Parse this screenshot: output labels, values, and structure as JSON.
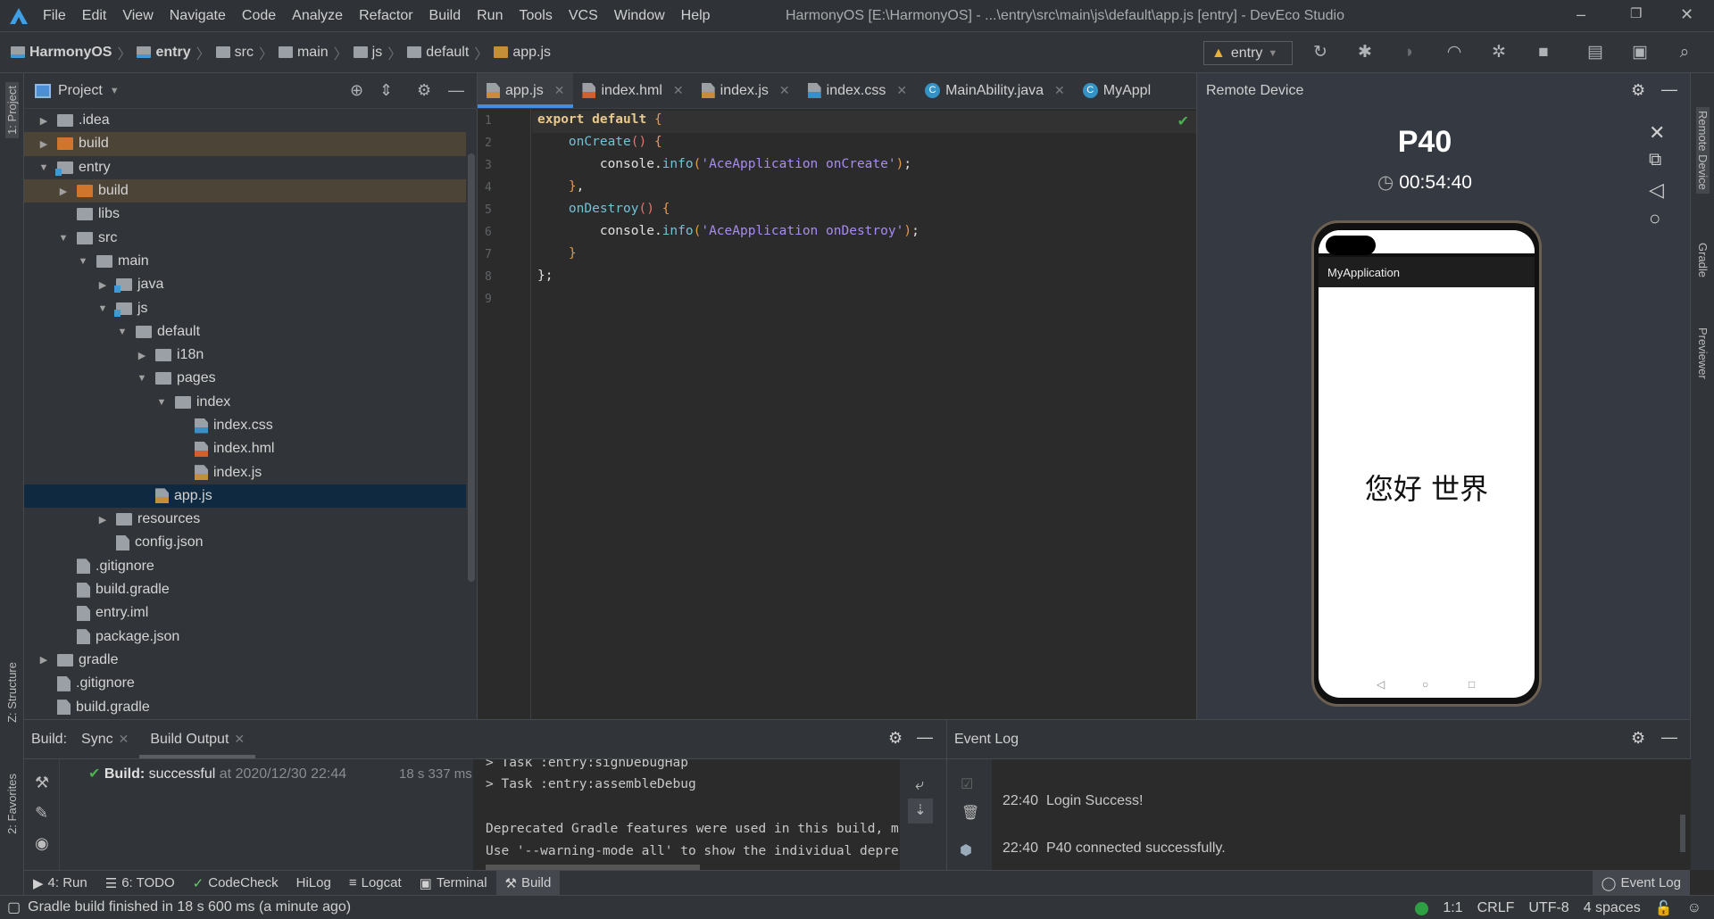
{
  "menu": {
    "items": [
      "File",
      "Edit",
      "View",
      "Navigate",
      "Code",
      "Analyze",
      "Refactor",
      "Build",
      "Run",
      "Tools",
      "VCS",
      "Window",
      "Help"
    ],
    "title": "HarmonyOS [E:\\HarmonyOS] - ...\\entry\\src\\main\\js\\default\\app.js [entry] - DevEco Studio"
  },
  "breadcrumb": [
    "HarmonyOS",
    "entry",
    "src",
    "main",
    "js",
    "default",
    "app.js"
  ],
  "toolbar": {
    "run_config": "entry"
  },
  "left_strip": {
    "project": "1: Project",
    "structure": "Z: Structure",
    "favorites": "2: Favorites"
  },
  "right_strip": {
    "remote": "Remote Device",
    "gradle": "Gradle",
    "previewer": "Previewer"
  },
  "project": {
    "title": "Project",
    "tree": [
      {
        "label": ".idea",
        "level": 1,
        "type": "folder",
        "arrow": "collapsed"
      },
      {
        "label": "build",
        "level": 1,
        "type": "folder",
        "color": "orange",
        "arrow": "collapsed",
        "hl": true
      },
      {
        "label": "entry",
        "level": 1,
        "type": "folder",
        "module": true,
        "arrow": "expanded"
      },
      {
        "label": "build",
        "level": 2,
        "type": "folder",
        "color": "orange",
        "arrow": "collapsed",
        "hl": true
      },
      {
        "label": "libs",
        "level": 2,
        "type": "folder"
      },
      {
        "label": "src",
        "level": 2,
        "type": "folder",
        "arrow": "expanded"
      },
      {
        "label": "main",
        "level": 3,
        "type": "folder",
        "arrow": "expanded"
      },
      {
        "label": "java",
        "level": 4,
        "type": "folder",
        "module": true,
        "arrow": "collapsed"
      },
      {
        "label": "js",
        "level": 4,
        "type": "folder",
        "module": true,
        "arrow": "expanded"
      },
      {
        "label": "default",
        "level": 5,
        "type": "folder",
        "arrow": "expanded"
      },
      {
        "label": "i18n",
        "level": 6,
        "type": "folder",
        "arrow": "collapsed"
      },
      {
        "label": "pages",
        "level": 6,
        "type": "folder",
        "arrow": "expanded"
      },
      {
        "label": "index",
        "level": 7,
        "type": "folder",
        "arrow": "expanded"
      },
      {
        "label": "index.css",
        "level": 8,
        "type": "css"
      },
      {
        "label": "index.hml",
        "level": 8,
        "type": "hml"
      },
      {
        "label": "index.js",
        "level": 8,
        "type": "js"
      },
      {
        "label": "app.js",
        "level": 6,
        "type": "js",
        "selected": true
      },
      {
        "label": "resources",
        "level": 4,
        "type": "folder",
        "arrow": "collapsed"
      },
      {
        "label": "config.json",
        "level": 4,
        "type": "json"
      },
      {
        "label": ".gitignore",
        "level": 2,
        "type": "generic"
      },
      {
        "label": "build.gradle",
        "level": 2,
        "type": "gradle"
      },
      {
        "label": "entry.iml",
        "level": 2,
        "type": "generic"
      },
      {
        "label": "package.json",
        "level": 2,
        "type": "json"
      },
      {
        "label": "gradle",
        "level": 1,
        "type": "folder",
        "arrow": "collapsed"
      },
      {
        "label": ".gitignore",
        "level": 1,
        "type": "generic"
      },
      {
        "label": "build.gradle",
        "level": 1,
        "type": "gradle"
      }
    ]
  },
  "editor": {
    "tabs": [
      {
        "label": "app.js",
        "type": "js",
        "active": true,
        "closable": true
      },
      {
        "label": "index.hml",
        "type": "hml",
        "closable": true
      },
      {
        "label": "index.js",
        "type": "js",
        "closable": true
      },
      {
        "label": "index.css",
        "type": "css",
        "closable": true
      },
      {
        "label": "MainAbility.java",
        "type": "class",
        "closable": true
      },
      {
        "label": "MyAppl",
        "type": "class",
        "closable": false
      }
    ],
    "line_numbers": [
      "1",
      "2",
      "3",
      "4",
      "5",
      "6",
      "7",
      "8",
      "9"
    ],
    "code": {
      "l1a": "export default",
      "l1b": " {",
      "l2a": "    onCreate",
      "l2b": "()",
      "l2c": " {",
      "l3a": "        console.",
      "l3b": "info",
      "l3c": "(",
      "l3d": "'AceApplication onCreate'",
      "l3e": ")",
      "l3f": ";",
      "l4a": "    }",
      "l4b": ",",
      "l5a": "    onDestroy",
      "l5b": "()",
      "l5c": " {",
      "l6a": "        console.",
      "l6b": "info",
      "l6c": "(",
      "l6d": "'AceApplication onDestroy'",
      "l6e": ")",
      "l6f": ";",
      "l7a": "    }",
      "l8a": "};"
    }
  },
  "remote": {
    "title": "Remote Device",
    "device": "P40",
    "timer": "00:54:40",
    "app_title": "MyApplication",
    "content": "您好 世界"
  },
  "build": {
    "label": "Build:",
    "tabs": [
      "Sync",
      "Build Output"
    ],
    "status_bold": "Build:",
    "status": " successful",
    "at": " at 2020/12/30 22:44",
    "duration": "18 s 337 ms",
    "console": [
      "> Task :entry:signDebugHap",
      "> Task :entry:assembleDebug",
      "Deprecated Gradle features were used in this build, m",
      "Use '--warning-mode all' to show the individual depre"
    ]
  },
  "event_log": {
    "title": "Event Log",
    "entries": [
      {
        "time": "22:40",
        "msg": "Login Success!"
      },
      {
        "time": "22:40",
        "msg": "P40 connected successfully."
      }
    ]
  },
  "tool_windows": [
    "4: Run",
    "6: TODO",
    "CodeCheck",
    "HiLog",
    "Logcat",
    "Terminal",
    "Build"
  ],
  "tool_windows_right": "Event Log",
  "status": {
    "message": "Gradle build finished in 18 s 600 ms (a minute ago)",
    "position": "1:1",
    "line_sep": "CRLF",
    "encoding": "UTF-8",
    "indent": "4 spaces"
  },
  "colors": {
    "accent": "#3f8ee8",
    "folder_excluded": "#d0762c",
    "success": "#4caf50"
  }
}
